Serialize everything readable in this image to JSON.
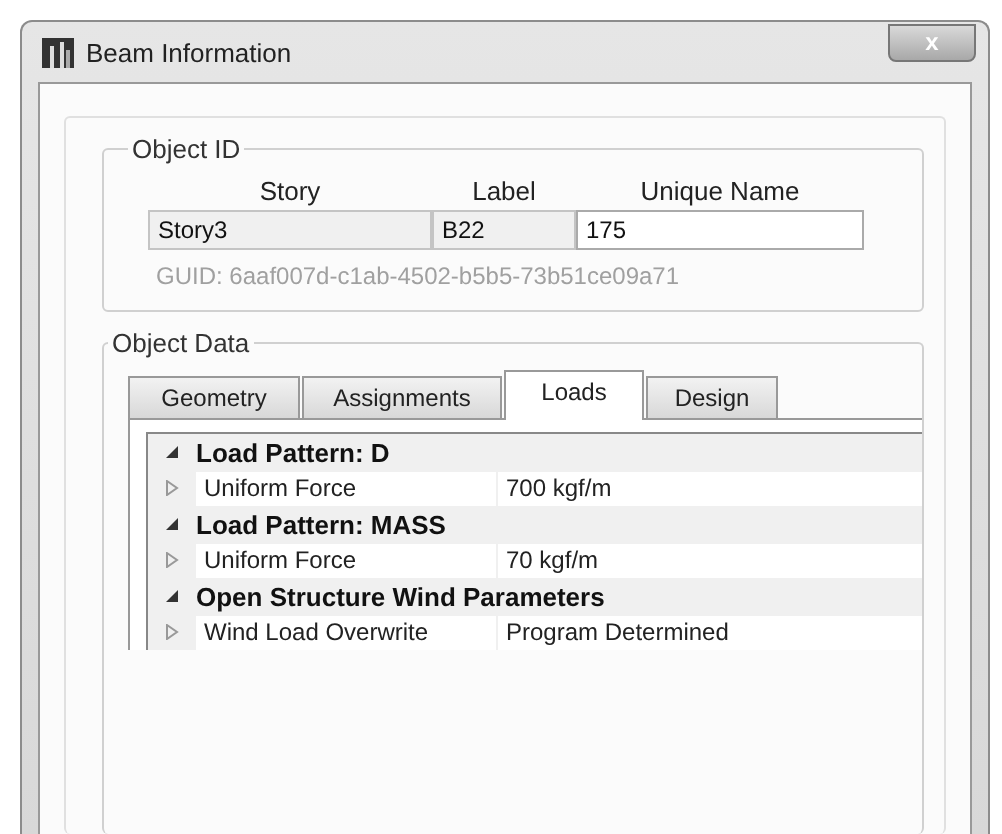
{
  "window": {
    "title": "Beam Information",
    "close_label": "x"
  },
  "object_id": {
    "legend": "Object ID",
    "columns": [
      "Story",
      "Label",
      "Unique Name"
    ],
    "fields": [
      {
        "value": "Story3",
        "disabled": true
      },
      {
        "value": "B22",
        "disabled": true
      },
      {
        "value": "175",
        "disabled": false
      }
    ],
    "guid": "GUID:  6aaf007d-c1ab-4502-b5b5-73b51ce09a71"
  },
  "object_data": {
    "legend": "Object Data",
    "tabs": [
      {
        "label": "Geometry",
        "selected": false
      },
      {
        "label": "Assignments",
        "selected": false
      },
      {
        "label": "Loads",
        "selected": true
      },
      {
        "label": "Design",
        "selected": false
      }
    ],
    "groups": [
      {
        "title": "Load Pattern: D",
        "expanded": true,
        "rows": [
          {
            "name": "Uniform Force",
            "value": "700 kgf/m",
            "expanded": false
          }
        ]
      },
      {
        "title": "Load Pattern: MASS",
        "expanded": true,
        "rows": [
          {
            "name": "Uniform Force",
            "value": "70 kgf/m",
            "expanded": false
          }
        ]
      },
      {
        "title": "Open Structure Wind Parameters",
        "expanded": true,
        "rows": [
          {
            "name": "Wind Load Overwrite",
            "value": "Program Determined",
            "expanded": false
          }
        ]
      }
    ]
  }
}
